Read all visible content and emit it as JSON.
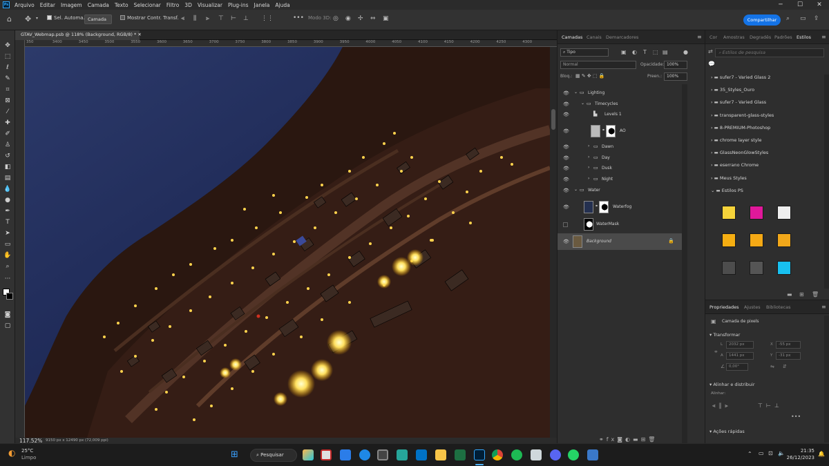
{
  "menu": [
    "Arquivo",
    "Editar",
    "Imagem",
    "Camada",
    "Texto",
    "Selecionar",
    "Filtro",
    "3D",
    "Visualizar",
    "Plug-ins",
    "Janela",
    "Ajuda"
  ],
  "options": {
    "auto_select_label": "Sel. Automa.",
    "auto_select_value": "Camada",
    "show_transform_label": "Mostrar Contr. Transf.",
    "mode3d_label": "Modo 3D:",
    "share_label": "Compartilhar"
  },
  "document": {
    "tab_title": "GTAV_Webmap.psb @ 118% (Background, RGB/8) *",
    "zoom": "117.52%",
    "size_info": "9150 px x 12490 px (72,009 ppi)",
    "ruler_labels": [
      "350",
      "3400",
      "3450",
      "3500",
      "3550",
      "3600",
      "3650",
      "3700",
      "3750",
      "3800",
      "3850",
      "3900",
      "3950",
      "4000",
      "4050",
      "4100",
      "4150",
      "4200",
      "4250",
      "4300"
    ]
  },
  "layers_panel": {
    "tabs": [
      "Camadas",
      "Canais",
      "Demarcadores"
    ],
    "filter_label": "Tipo",
    "blend_mode": "Normal",
    "opacity_label": "Opacidade:",
    "opacity_value": "100%",
    "lock_label": "Bloq.:",
    "fill_label": "Preen.:",
    "fill_value": "100%",
    "layers": [
      {
        "name": "Lighting",
        "indent": 0,
        "kind": "group"
      },
      {
        "name": "Timecycles",
        "indent": 1,
        "kind": "group"
      },
      {
        "name": "Levels 1",
        "indent": 2,
        "kind": "adjust"
      },
      {
        "name": "AO",
        "indent": 2,
        "kind": "masked"
      },
      {
        "name": "Dawn",
        "indent": 2,
        "kind": "group"
      },
      {
        "name": "Day",
        "indent": 2,
        "kind": "group"
      },
      {
        "name": "Dusk",
        "indent": 2,
        "kind": "group"
      },
      {
        "name": "Night",
        "indent": 2,
        "kind": "group"
      },
      {
        "name": "Water",
        "indent": 0,
        "kind": "group"
      },
      {
        "name": "Waterfog",
        "indent": 1,
        "kind": "masked"
      },
      {
        "name": "WaterMask",
        "indent": 1,
        "kind": "mask"
      },
      {
        "name": "Background",
        "indent": 0,
        "kind": "image"
      }
    ]
  },
  "styles_panel": {
    "tabs": [
      "Cor",
      "Amostras",
      "Degradês",
      "Padrões",
      "Estilos"
    ],
    "search_placeholder": "Estilos de pesquisa",
    "folders": [
      "sufer7 - Varied Glass 2",
      "35_Styles_Ouro",
      "sufer7 - Varied Glass",
      "transparent-glass-styles",
      "8-PREMIUM-Photoshop",
      "chrome layer style",
      "GlassNeonGlowStyles",
      "eserrano Chrome",
      "Meus Styles",
      "Estilos PS"
    ],
    "swatch_colors": [
      "#f5d33a",
      "#e0189a",
      "#eeeeee",
      "#f5ae12",
      "#f5a915",
      "#f2a81a",
      "#4d4d4d",
      "#555555",
      "#18c0f0"
    ]
  },
  "properties_panel": {
    "tabs": [
      "Propriedades",
      "Ajustes",
      "Bibliotecas"
    ],
    "layer_type": "Camada de pixels",
    "transform_title": "Transformar",
    "w_label": "L",
    "w_value": "2032 px",
    "x_label": "X",
    "x_value": "-55 px",
    "h_label": "A",
    "h_value": "1441 px",
    "y_label": "Y",
    "y_value": "-31 px",
    "angle_value": "0,00°",
    "align_title": "Alinhar e distribuir",
    "align_sub": "Alinhar:",
    "quick_actions": "Ações rápidas"
  },
  "taskbar": {
    "temp": "25°C",
    "weather": "Limpo",
    "search_label": "Pesquisar",
    "time": "21:35",
    "date": "26/12/2023"
  }
}
